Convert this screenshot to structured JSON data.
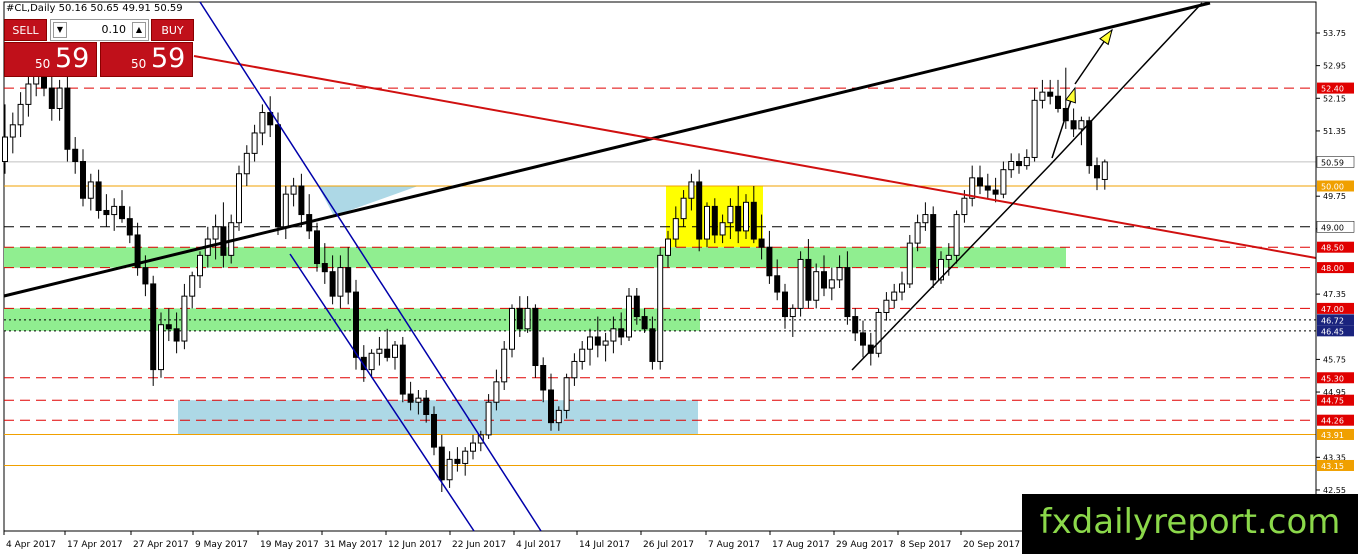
{
  "chart_title": "#CL,Daily  50.16 50.65 49.91 50.59",
  "trade_panel": {
    "sell_label": "SELL",
    "buy_label": "BUY",
    "lot": "0.10",
    "sell_small": "50",
    "sell_big": "59",
    "buy_small": "50",
    "buy_big": "59"
  },
  "watermark": "fxdailyreport.com",
  "colors": {
    "bull_candle": "#ffffff",
    "bear_candle": "#000000",
    "resistance": "#e00000",
    "orange_level": "#f0a000",
    "channel": "#0000aa",
    "trend_black": "#000000",
    "zone_green": "#90ee90",
    "zone_blue": "#add8e6",
    "zone_yellow": "#ffff00",
    "arrow": "#ffff33"
  },
  "chart_data": {
    "type": "candlestick",
    "instrument": "#CL",
    "timeframe": "Daily",
    "ohlc_last": {
      "open": 50.16,
      "high": 50.65,
      "low": 49.91,
      "close": 50.59
    },
    "ylim": [
      42.5,
      54.4
    ],
    "xlabels": [
      "4 Apr 2017",
      "17 Apr 2017",
      "27 Apr 2017",
      "9 May 2017",
      "19 May 2017",
      "31 May 2017",
      "12 Jun 2017",
      "22 Jun 2017",
      "4 Jul 2017",
      "14 Jul 2017",
      "26 Jul 2017",
      "7 Aug 2017",
      "17 Aug 2017",
      "29 Aug 2017",
      "8 Sep 2017",
      "20 Sep 2017"
    ],
    "yticks": [
      "53.75",
      "52.95",
      "52.15",
      "51.35",
      "49.75",
      "48.95",
      "47.35",
      "45.75",
      "44.95",
      "43.35",
      "42.55"
    ],
    "level_labels": [
      {
        "text": "52.40",
        "value": 52.4,
        "kind": "red"
      },
      {
        "text": "50.59",
        "value": 50.59,
        "kind": "price"
      },
      {
        "text": "50.00",
        "value": 50.0,
        "kind": "orange"
      },
      {
        "text": "49.00",
        "value": 49.0,
        "kind": "black"
      },
      {
        "text": "48.50",
        "value": 48.5,
        "kind": "red"
      },
      {
        "text": "48.00",
        "value": 48.0,
        "kind": "red"
      },
      {
        "text": "47.00",
        "value": 47.0,
        "kind": "red"
      },
      {
        "text": "46.72",
        "value": 46.72,
        "kind": "blue"
      },
      {
        "text": "46.45",
        "value": 46.45,
        "kind": "blue"
      },
      {
        "text": "45.30",
        "value": 45.3,
        "kind": "red"
      },
      {
        "text": "44.75",
        "value": 44.75,
        "kind": "red"
      },
      {
        "text": "44.26",
        "value": 44.26,
        "kind": "red"
      },
      {
        "text": "43.91",
        "value": 43.91,
        "kind": "orange"
      },
      {
        "text": "43.15",
        "value": 43.15,
        "kind": "orange"
      }
    ],
    "candles": [
      {
        "o": 50.6,
        "h": 52.0,
        "l": 50.3,
        "c": 51.2
      },
      {
        "o": 51.2,
        "h": 51.8,
        "l": 50.8,
        "c": 51.5
      },
      {
        "o": 51.5,
        "h": 52.3,
        "l": 51.2,
        "c": 52.0
      },
      {
        "o": 52.0,
        "h": 52.8,
        "l": 51.7,
        "c": 52.5
      },
      {
        "o": 52.5,
        "h": 53.1,
        "l": 52.2,
        "c": 52.7
      },
      {
        "o": 52.7,
        "h": 53.2,
        "l": 52.2,
        "c": 52.4
      },
      {
        "o": 52.4,
        "h": 52.8,
        "l": 51.6,
        "c": 51.9
      },
      {
        "o": 51.9,
        "h": 52.6,
        "l": 51.6,
        "c": 52.4
      },
      {
        "o": 52.4,
        "h": 52.8,
        "l": 50.6,
        "c": 50.9
      },
      {
        "o": 50.9,
        "h": 51.2,
        "l": 50.3,
        "c": 50.6
      },
      {
        "o": 50.6,
        "h": 50.9,
        "l": 49.5,
        "c": 49.7
      },
      {
        "o": 49.7,
        "h": 50.3,
        "l": 49.4,
        "c": 50.1
      },
      {
        "o": 50.1,
        "h": 50.4,
        "l": 49.2,
        "c": 49.4
      },
      {
        "o": 49.4,
        "h": 49.8,
        "l": 49.0,
        "c": 49.3
      },
      {
        "o": 49.3,
        "h": 49.7,
        "l": 48.9,
        "c": 49.5
      },
      {
        "o": 49.5,
        "h": 49.9,
        "l": 49.1,
        "c": 49.2
      },
      {
        "o": 49.2,
        "h": 49.5,
        "l": 48.6,
        "c": 48.8
      },
      {
        "o": 48.8,
        "h": 49.1,
        "l": 47.8,
        "c": 48.0
      },
      {
        "o": 48.0,
        "h": 48.3,
        "l": 47.3,
        "c": 47.6
      },
      {
        "o": 47.6,
        "h": 47.8,
        "l": 45.1,
        "c": 45.5
      },
      {
        "o": 45.5,
        "h": 46.9,
        "l": 45.3,
        "c": 46.6
      },
      {
        "o": 46.6,
        "h": 47.0,
        "l": 46.2,
        "c": 46.5
      },
      {
        "o": 46.5,
        "h": 46.9,
        "l": 45.9,
        "c": 46.2
      },
      {
        "o": 46.2,
        "h": 47.6,
        "l": 46.0,
        "c": 47.3
      },
      {
        "o": 47.3,
        "h": 47.9,
        "l": 47.0,
        "c": 47.8
      },
      {
        "o": 47.8,
        "h": 48.4,
        "l": 47.5,
        "c": 48.3
      },
      {
        "o": 48.3,
        "h": 49.0,
        "l": 48.0,
        "c": 48.7
      },
      {
        "o": 48.7,
        "h": 49.3,
        "l": 48.2,
        "c": 49.0
      },
      {
        "o": 49.0,
        "h": 49.6,
        "l": 48.0,
        "c": 48.3
      },
      {
        "o": 48.3,
        "h": 49.3,
        "l": 48.1,
        "c": 49.1
      },
      {
        "o": 49.1,
        "h": 50.5,
        "l": 48.9,
        "c": 50.3
      },
      {
        "o": 50.3,
        "h": 51.0,
        "l": 50.0,
        "c": 50.8
      },
      {
        "o": 50.8,
        "h": 51.5,
        "l": 50.6,
        "c": 51.3
      },
      {
        "o": 51.3,
        "h": 52.0,
        "l": 51.0,
        "c": 51.8
      },
      {
        "o": 51.8,
        "h": 52.2,
        "l": 51.2,
        "c": 51.5
      },
      {
        "o": 51.5,
        "h": 51.8,
        "l": 48.8,
        "c": 49.0
      },
      {
        "o": 49.0,
        "h": 50.0,
        "l": 48.7,
        "c": 49.8
      },
      {
        "o": 49.8,
        "h": 50.2,
        "l": 49.5,
        "c": 50.0
      },
      {
        "o": 50.0,
        "h": 50.3,
        "l": 49.0,
        "c": 49.3
      },
      {
        "o": 49.3,
        "h": 49.8,
        "l": 48.7,
        "c": 48.9
      },
      {
        "o": 48.9,
        "h": 49.1,
        "l": 47.9,
        "c": 48.1
      },
      {
        "o": 48.1,
        "h": 48.6,
        "l": 47.6,
        "c": 47.9
      },
      {
        "o": 47.9,
        "h": 48.3,
        "l": 47.1,
        "c": 47.3
      },
      {
        "o": 47.3,
        "h": 48.3,
        "l": 47.0,
        "c": 48.0
      },
      {
        "o": 48.0,
        "h": 48.5,
        "l": 47.1,
        "c": 47.4
      },
      {
        "o": 47.4,
        "h": 47.7,
        "l": 45.5,
        "c": 45.8
      },
      {
        "o": 45.8,
        "h": 46.1,
        "l": 45.2,
        "c": 45.5
      },
      {
        "o": 45.5,
        "h": 46.0,
        "l": 45.3,
        "c": 45.9
      },
      {
        "o": 45.9,
        "h": 46.3,
        "l": 45.6,
        "c": 46.0
      },
      {
        "o": 46.0,
        "h": 46.5,
        "l": 45.7,
        "c": 45.8
      },
      {
        "o": 45.8,
        "h": 46.2,
        "l": 45.5,
        "c": 46.1
      },
      {
        "o": 46.1,
        "h": 46.3,
        "l": 44.7,
        "c": 44.9
      },
      {
        "o": 44.9,
        "h": 45.2,
        "l": 44.5,
        "c": 44.7
      },
      {
        "o": 44.7,
        "h": 45.0,
        "l": 44.4,
        "c": 44.8
      },
      {
        "o": 44.8,
        "h": 45.0,
        "l": 44.2,
        "c": 44.4
      },
      {
        "o": 44.4,
        "h": 44.6,
        "l": 43.4,
        "c": 43.6
      },
      {
        "o": 43.6,
        "h": 43.9,
        "l": 42.5,
        "c": 42.8
      },
      {
        "o": 42.8,
        "h": 43.5,
        "l": 42.6,
        "c": 43.3
      },
      {
        "o": 43.3,
        "h": 43.6,
        "l": 43.0,
        "c": 43.2
      },
      {
        "o": 43.2,
        "h": 43.6,
        "l": 42.9,
        "c": 43.5
      },
      {
        "o": 43.5,
        "h": 43.9,
        "l": 43.3,
        "c": 43.7
      },
      {
        "o": 43.7,
        "h": 44.0,
        "l": 43.5,
        "c": 43.9
      },
      {
        "o": 43.9,
        "h": 44.9,
        "l": 43.8,
        "c": 44.7
      },
      {
        "o": 44.7,
        "h": 45.5,
        "l": 44.5,
        "c": 45.2
      },
      {
        "o": 45.2,
        "h": 46.2,
        "l": 45.0,
        "c": 46.0
      },
      {
        "o": 46.0,
        "h": 47.1,
        "l": 45.8,
        "c": 47.0
      },
      {
        "o": 47.0,
        "h": 47.3,
        "l": 46.3,
        "c": 46.5
      },
      {
        "o": 46.5,
        "h": 47.3,
        "l": 46.4,
        "c": 47.0
      },
      {
        "o": 47.0,
        "h": 47.1,
        "l": 45.3,
        "c": 45.6
      },
      {
        "o": 45.6,
        "h": 45.8,
        "l": 44.7,
        "c": 45.0
      },
      {
        "o": 45.0,
        "h": 45.4,
        "l": 44.0,
        "c": 44.2
      },
      {
        "o": 44.2,
        "h": 44.6,
        "l": 44.0,
        "c": 44.5
      },
      {
        "o": 44.5,
        "h": 45.4,
        "l": 44.3,
        "c": 45.3
      },
      {
        "o": 45.3,
        "h": 45.9,
        "l": 45.1,
        "c": 45.7
      },
      {
        "o": 45.7,
        "h": 46.2,
        "l": 45.5,
        "c": 46.0
      },
      {
        "o": 46.0,
        "h": 46.5,
        "l": 45.6,
        "c": 46.3
      },
      {
        "o": 46.3,
        "h": 46.8,
        "l": 45.8,
        "c": 46.1
      },
      {
        "o": 46.1,
        "h": 46.4,
        "l": 45.7,
        "c": 46.2
      },
      {
        "o": 46.2,
        "h": 46.8,
        "l": 45.9,
        "c": 46.5
      },
      {
        "o": 46.5,
        "h": 46.9,
        "l": 46.1,
        "c": 46.3
      },
      {
        "o": 46.3,
        "h": 47.5,
        "l": 46.2,
        "c": 47.3
      },
      {
        "o": 47.3,
        "h": 47.5,
        "l": 46.6,
        "c": 46.8
      },
      {
        "o": 46.8,
        "h": 47.0,
        "l": 46.4,
        "c": 46.5
      },
      {
        "o": 46.5,
        "h": 46.8,
        "l": 45.5,
        "c": 45.7
      },
      {
        "o": 45.7,
        "h": 48.5,
        "l": 45.5,
        "c": 48.3
      },
      {
        "o": 48.3,
        "h": 48.9,
        "l": 48.0,
        "c": 48.7
      },
      {
        "o": 48.7,
        "h": 49.5,
        "l": 48.5,
        "c": 49.2
      },
      {
        "o": 49.2,
        "h": 49.9,
        "l": 49.0,
        "c": 49.7
      },
      {
        "o": 49.7,
        "h": 50.3,
        "l": 49.4,
        "c": 50.1
      },
      {
        "o": 50.1,
        "h": 50.4,
        "l": 48.4,
        "c": 48.7
      },
      {
        "o": 48.7,
        "h": 49.6,
        "l": 48.5,
        "c": 49.5
      },
      {
        "o": 49.5,
        "h": 49.7,
        "l": 48.6,
        "c": 48.8
      },
      {
        "o": 48.8,
        "h": 49.3,
        "l": 48.6,
        "c": 49.1
      },
      {
        "o": 49.1,
        "h": 49.7,
        "l": 48.7,
        "c": 49.5
      },
      {
        "o": 49.5,
        "h": 50.0,
        "l": 48.6,
        "c": 48.9
      },
      {
        "o": 48.9,
        "h": 49.8,
        "l": 48.7,
        "c": 49.6
      },
      {
        "o": 49.6,
        "h": 50.0,
        "l": 48.6,
        "c": 48.7
      },
      {
        "o": 48.7,
        "h": 49.3,
        "l": 48.2,
        "c": 48.5
      },
      {
        "o": 48.5,
        "h": 48.9,
        "l": 47.6,
        "c": 47.8
      },
      {
        "o": 47.8,
        "h": 48.2,
        "l": 47.2,
        "c": 47.4
      },
      {
        "o": 47.4,
        "h": 47.6,
        "l": 46.5,
        "c": 46.8
      },
      {
        "o": 46.8,
        "h": 47.1,
        "l": 46.3,
        "c": 47.0
      },
      {
        "o": 47.0,
        "h": 48.4,
        "l": 46.8,
        "c": 48.2
      },
      {
        "o": 48.2,
        "h": 48.7,
        "l": 47.0,
        "c": 47.2
      },
      {
        "o": 47.2,
        "h": 48.1,
        "l": 47.0,
        "c": 47.9
      },
      {
        "o": 47.9,
        "h": 48.3,
        "l": 47.3,
        "c": 47.5
      },
      {
        "o": 47.5,
        "h": 48.0,
        "l": 47.2,
        "c": 47.7
      },
      {
        "o": 47.7,
        "h": 48.3,
        "l": 47.5,
        "c": 48.0
      },
      {
        "o": 48.0,
        "h": 48.4,
        "l": 46.6,
        "c": 46.8
      },
      {
        "o": 46.8,
        "h": 47.0,
        "l": 46.2,
        "c": 46.4
      },
      {
        "o": 46.4,
        "h": 46.7,
        "l": 45.8,
        "c": 46.1
      },
      {
        "o": 46.1,
        "h": 46.4,
        "l": 45.6,
        "c": 45.9
      },
      {
        "o": 45.9,
        "h": 47.0,
        "l": 45.8,
        "c": 46.9
      },
      {
        "o": 46.9,
        "h": 47.4,
        "l": 46.7,
        "c": 47.2
      },
      {
        "o": 47.2,
        "h": 47.6,
        "l": 47.0,
        "c": 47.4
      },
      {
        "o": 47.4,
        "h": 47.9,
        "l": 47.2,
        "c": 47.6
      },
      {
        "o": 47.6,
        "h": 48.8,
        "l": 47.5,
        "c": 48.6
      },
      {
        "o": 48.6,
        "h": 49.3,
        "l": 48.4,
        "c": 49.1
      },
      {
        "o": 49.1,
        "h": 49.6,
        "l": 48.9,
        "c": 49.3
      },
      {
        "o": 49.3,
        "h": 49.5,
        "l": 47.5,
        "c": 47.7
      },
      {
        "o": 47.7,
        "h": 48.4,
        "l": 47.6,
        "c": 48.2
      },
      {
        "o": 48.2,
        "h": 48.6,
        "l": 47.8,
        "c": 48.3
      },
      {
        "o": 48.3,
        "h": 49.4,
        "l": 48.1,
        "c": 49.3
      },
      {
        "o": 49.3,
        "h": 49.9,
        "l": 49.1,
        "c": 49.7
      },
      {
        "o": 49.7,
        "h": 50.5,
        "l": 49.5,
        "c": 50.2
      },
      {
        "o": 50.2,
        "h": 50.5,
        "l": 49.8,
        "c": 50.0
      },
      {
        "o": 50.0,
        "h": 50.3,
        "l": 49.7,
        "c": 49.9
      },
      {
        "o": 49.9,
        "h": 50.2,
        "l": 49.6,
        "c": 49.8
      },
      {
        "o": 49.8,
        "h": 50.6,
        "l": 49.7,
        "c": 50.4
      },
      {
        "o": 50.4,
        "h": 50.8,
        "l": 50.2,
        "c": 50.6
      },
      {
        "o": 50.6,
        "h": 50.8,
        "l": 50.3,
        "c": 50.5
      },
      {
        "o": 50.5,
        "h": 50.9,
        "l": 50.4,
        "c": 50.7
      },
      {
        "o": 50.7,
        "h": 52.4,
        "l": 50.6,
        "c": 52.1
      },
      {
        "o": 52.1,
        "h": 52.6,
        "l": 51.9,
        "c": 52.3
      },
      {
        "o": 52.3,
        "h": 52.6,
        "l": 52.0,
        "c": 52.2
      },
      {
        "o": 52.2,
        "h": 52.6,
        "l": 51.8,
        "c": 51.9
      },
      {
        "o": 51.9,
        "h": 52.9,
        "l": 51.4,
        "c": 51.6
      },
      {
        "o": 51.6,
        "h": 51.9,
        "l": 51.2,
        "c": 51.4
      },
      {
        "o": 51.4,
        "h": 51.7,
        "l": 51.0,
        "c": 51.6
      },
      {
        "o": 51.6,
        "h": 51.7,
        "l": 50.3,
        "c": 50.5
      },
      {
        "o": 50.5,
        "h": 50.7,
        "l": 49.9,
        "c": 50.2
      },
      {
        "o": 50.16,
        "h": 50.65,
        "l": 49.91,
        "c": 50.59
      }
    ]
  }
}
